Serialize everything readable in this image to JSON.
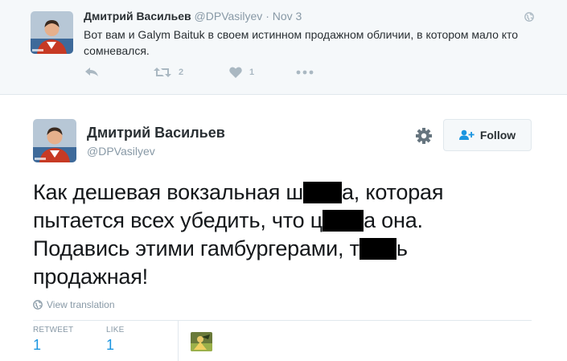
{
  "parent_tweet": {
    "name": "Дмитрий Васильев",
    "handle": "@DPVasilyev",
    "separator": "·",
    "date": "Nov 3",
    "text": "Вот вам и Galym Baituk в своем истинном продажном обличии, в котором мало кто сомневался.",
    "retweet_count": "2",
    "like_count": "1",
    "icons": [
      "reply-icon",
      "retweet-icon",
      "heart-icon",
      "more-icon",
      "globe-icon"
    ]
  },
  "main_tweet": {
    "name": "Дмитрий Васильев",
    "handle": "@DPVasilyev",
    "follow_label": "Follow",
    "text_parts": {
      "l1a": "Как дешевая вокзальная ш",
      "l1b": "а, которая",
      "l2a": "пытается всех убедить, что ц",
      "l2b": "а она.",
      "l3a": "Подавись этими гамбургерами, т",
      "l3b": "ь",
      "l4": "продажная!"
    },
    "translate_label": "View translation",
    "stats": {
      "retweet_label": "RETWEET",
      "retweet_value": "1",
      "like_label": "LIKE",
      "like_value": "1"
    },
    "icons": [
      "gear-icon",
      "follow-person-icon",
      "globe-icon"
    ]
  },
  "colors": {
    "accent": "#1b95e0",
    "muted": "#8899a6",
    "parent_bg": "#f5f8fa",
    "border": "#e1e8ed"
  }
}
